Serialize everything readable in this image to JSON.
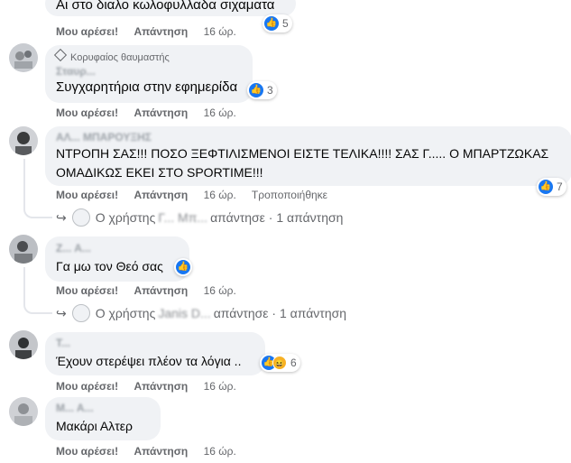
{
  "actions": {
    "like": "Μου αρέσει!",
    "reply": "Απάντηση"
  },
  "comments": [
    {
      "text": "Αι στο διαλο κωλοφυλλαδα σιχαματα",
      "reactions": "5",
      "time": "16 ώρ."
    },
    {
      "badge": "Κορυφαίος θαυμαστής",
      "name": "Σταυρ...",
      "text": "Συγχαρητήρια στην εφημερίδα",
      "reactions": "3",
      "time": "16 ώρ."
    },
    {
      "name": "ΑΛ... ΜΠΑΡΟΥΞΗΣ",
      "text_line1": "ΝΤΡΟΠΗ ΣΑΣ!!! ΠΟΣΟ ΞΕΦΤΙΛΙΣΜΕΝΟΙ ΕΙΣΤΕ ΤΕΛΙΚΑ!!!! ΣΑΣ Γ..... Ο ΜΠΑΡΤΖΩΚΑΣ",
      "text_line2": "ΟΜΑΔΙΚΩΣ ΕΚΕΙ ΣΤΟ SPORTIME!!!",
      "reactions": "7",
      "time": "16 ώρ.",
      "edited": "Τροποποιήθηκε",
      "reply": {
        "prefix": "Ο χρήστης",
        "user": "Γ... Μπ...",
        "suffix": "απάντησε · 1 απάντηση"
      }
    },
    {
      "name": "Ζ... Α...",
      "text": "Γα μω τον Θεό σας",
      "time": "16 ώρ.",
      "reply": {
        "prefix": "Ο χρήστης",
        "user": "Janis D...",
        "suffix": "απάντησε · 1 απάντηση"
      }
    },
    {
      "name": "Τ...",
      "text": "Έχουν στερέψει πλέον τα λόγια ..",
      "reactions": "6",
      "time": "16 ώρ."
    },
    {
      "name": "Μ... Α...",
      "text": "Μακάρι Αλτερ",
      "time": "16 ώρ."
    }
  ],
  "colors": {
    "like_blue": "#1877f2",
    "bubble": "#f0f2f5",
    "meta_text": "#65676b",
    "haha": "#f7b125"
  },
  "icons": {
    "like": "thumbs-up-icon",
    "haha": "laughing-face-icon",
    "badge": "diamond-icon",
    "reply": "reply-arrow-icon"
  }
}
